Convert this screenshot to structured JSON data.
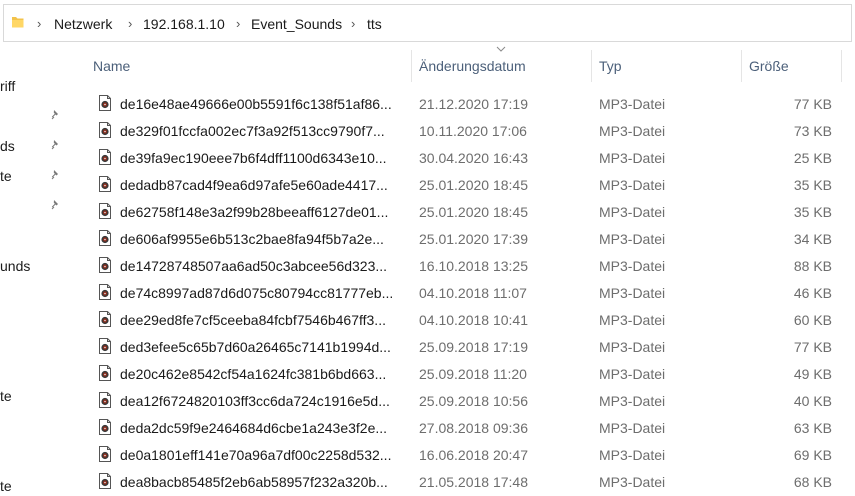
{
  "breadcrumb": [
    "Netzwerk",
    "192.168.1.10",
    "Event_Sounds",
    "tts"
  ],
  "nav": {
    "items": [
      {
        "label": "riff",
        "pinned": false
      },
      {
        "label": "",
        "pinned": true
      },
      {
        "label": "ds",
        "pinned": true
      },
      {
        "label": "te",
        "pinned": true
      },
      {
        "label": "",
        "pinned": true
      },
      {
        "label": "unds",
        "pinned": false
      },
      {
        "label": "te",
        "pinned": false
      },
      {
        "label": "te",
        "pinned": false
      }
    ]
  },
  "columns": {
    "name": "Name",
    "date": "Änderungsdatum",
    "type": "Typ",
    "size": "Größe"
  },
  "files": [
    {
      "name": "de16e48ae49666e00b5591f6c138f51af86...",
      "date": "21.12.2020 17:19",
      "type": "MP3-Datei",
      "size": "77 KB"
    },
    {
      "name": "de329f01fccfa002ec7f3a92f513cc9790f7...",
      "date": "10.11.2020 17:06",
      "type": "MP3-Datei",
      "size": "73 KB"
    },
    {
      "name": "de39fa9ec190eee7b6f4dff1100d6343e10...",
      "date": "30.04.2020 16:43",
      "type": "MP3-Datei",
      "size": "25 KB"
    },
    {
      "name": "dedadb87cad4f9ea6d97afe5e60ade4417...",
      "date": "25.01.2020 18:45",
      "type": "MP3-Datei",
      "size": "35 KB"
    },
    {
      "name": "de62758f148e3a2f99b28beeaff6127de01...",
      "date": "25.01.2020 18:45",
      "type": "MP3-Datei",
      "size": "35 KB"
    },
    {
      "name": "de606af9955e6b513c2bae8fa94f5b7a2e...",
      "date": "25.01.2020 17:39",
      "type": "MP3-Datei",
      "size": "34 KB"
    },
    {
      "name": "de14728748507aa6ad50c3abcee56d323...",
      "date": "16.10.2018 13:25",
      "type": "MP3-Datei",
      "size": "88 KB"
    },
    {
      "name": "de74c8997ad87d6d075c80794cc81777eb...",
      "date": "04.10.2018 11:07",
      "type": "MP3-Datei",
      "size": "46 KB"
    },
    {
      "name": "dee29ed8fe7cf5ceeba84fcbf7546b467ff3...",
      "date": "04.10.2018 10:41",
      "type": "MP3-Datei",
      "size": "60 KB"
    },
    {
      "name": "ded3efee5c65b7d60a26465c7141b1994d...",
      "date": "25.09.2018 17:19",
      "type": "MP3-Datei",
      "size": "77 KB"
    },
    {
      "name": "de20c462e8542cf54a1624fc381b6bd663...",
      "date": "25.09.2018 11:20",
      "type": "MP3-Datei",
      "size": "49 KB"
    },
    {
      "name": "dea12f6724820103ff3cc6da724c1916e5d...",
      "date": "25.09.2018 10:56",
      "type": "MP3-Datei",
      "size": "40 KB"
    },
    {
      "name": "deda2dc59f9e2464684d6cbe1a243e3f2e...",
      "date": "27.08.2018 09:36",
      "type": "MP3-Datei",
      "size": "63 KB"
    },
    {
      "name": "de0a1801eff141e70a96a7df00c2258d532...",
      "date": "16.06.2018 20:47",
      "type": "MP3-Datei",
      "size": "69 KB"
    },
    {
      "name": "dea8bacb85485f2eb6ab58957f232a320b...",
      "date": "21.05.2018 17:48",
      "type": "MP3-Datei",
      "size": "68 KB"
    }
  ]
}
